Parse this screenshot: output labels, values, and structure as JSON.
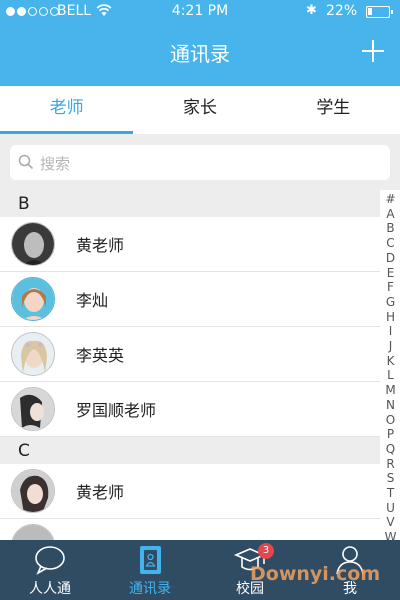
{
  "status_bar": {
    "carrier": "BELL",
    "time": "4:21 PM",
    "battery": "22%",
    "battery_level": 0.22
  },
  "header": {
    "title": "通讯录"
  },
  "tabs": [
    {
      "label": "老师"
    },
    {
      "label": "家长"
    },
    {
      "label": "学生"
    }
  ],
  "search": {
    "placeholder": "搜索"
  },
  "sections": [
    {
      "letter": "B",
      "contacts": [
        {
          "name": "黄老师"
        },
        {
          "name": "李灿"
        },
        {
          "name": "李英英"
        },
        {
          "name": "罗国顺老师"
        }
      ]
    },
    {
      "letter": "C",
      "contacts": [
        {
          "name": "黄老师"
        }
      ]
    }
  ],
  "alphabet_index": [
    "#",
    "A",
    "B",
    "C",
    "D",
    "E",
    "F",
    "G",
    "H",
    "I",
    "J",
    "K",
    "L",
    "M",
    "N",
    "O",
    "P",
    "Q",
    "R",
    "S",
    "T",
    "U",
    "V",
    "W"
  ],
  "tabbar": [
    {
      "label": "人人通",
      "icon": "chat-bubble-icon"
    },
    {
      "label": "通讯录",
      "icon": "contacts-book-icon"
    },
    {
      "label": "校园",
      "icon": "graduation-cap-icon",
      "badge": "3"
    },
    {
      "label": "我",
      "icon": "person-icon"
    }
  ],
  "watermark": "Downyi.com",
  "colors": {
    "header_blue": "#47b5ec",
    "accent": "#3aa6e3",
    "tabbar_bg": "#2f4c63",
    "badge_red": "#e2474c"
  }
}
